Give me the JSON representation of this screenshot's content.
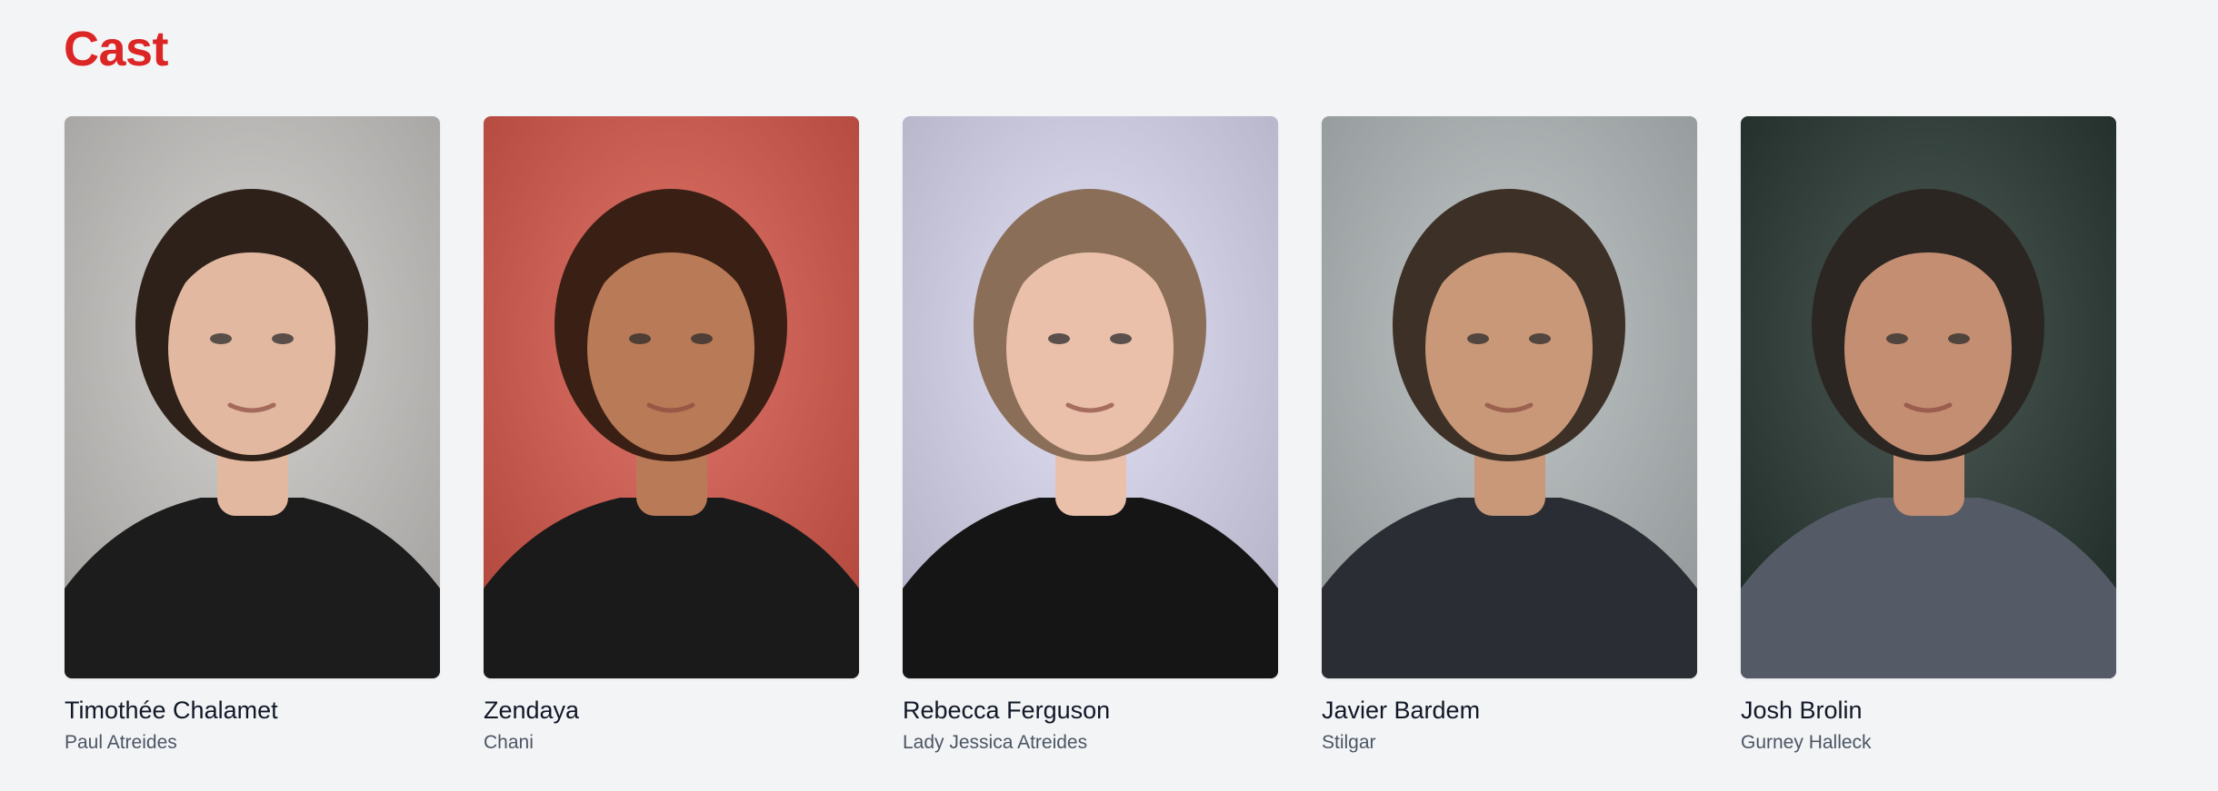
{
  "section": {
    "title": "Cast",
    "title_color": "#dc2626"
  },
  "cast": [
    {
      "actor": "Timothée Chalamet",
      "character": "Paul Atreides",
      "portrait": "portrait-photo",
      "background_color": "#c9c7c4",
      "hair_color": "#2e2119",
      "skin_color": "#e2b8a0",
      "clothing_color": "#1c1c1c"
    },
    {
      "actor": "Zendaya",
      "character": "Chani",
      "portrait": "portrait-photo",
      "background_color": "#d9574a",
      "hair_color": "#3a1f14",
      "skin_color": "#b97a57",
      "clothing_color": "#1a1a1a"
    },
    {
      "actor": "Rebecca Ferguson",
      "character": "Lady Jessica Atreides",
      "portrait": "portrait-photo",
      "background_color": "#dcdaf3",
      "hair_color": "#8a6e57",
      "skin_color": "#eac0ab",
      "clothing_color": "#151515"
    },
    {
      "actor": "Javier Bardem",
      "character": "Stilgar",
      "portrait": "portrait-photo",
      "background_color": "#b3babb",
      "hair_color": "#3d3026",
      "skin_color": "#c89878",
      "clothing_color": "#2a2d33"
    },
    {
      "actor": "Josh Brolin",
      "character": "Gurney Halleck",
      "portrait": "portrait-photo",
      "background_color": "#263630",
      "hair_color": "#2c2622",
      "skin_color": "#c48e72",
      "clothing_color": "#555b66"
    }
  ]
}
